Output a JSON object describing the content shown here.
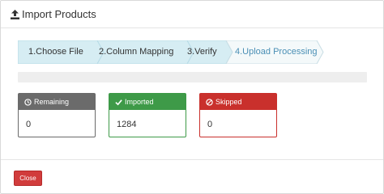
{
  "modal": {
    "title": "Import Products",
    "title_icon": "upload-icon"
  },
  "wizard": {
    "steps": [
      {
        "label": "1.Choose File",
        "state": "completed"
      },
      {
        "label": "2.Column Mapping",
        "state": "completed"
      },
      {
        "label": "3.Verify",
        "state": "completed"
      },
      {
        "label": "4.Upload Processing",
        "state": "active"
      }
    ]
  },
  "progress": {
    "value": 0
  },
  "stats": {
    "remaining": {
      "label": "Remaining",
      "icon": "clock-icon",
      "value": "0",
      "color": "#6b6b6b"
    },
    "imported": {
      "label": "Imported",
      "icon": "check-icon",
      "value": "1284",
      "color": "#3e9a48"
    },
    "skipped": {
      "label": "Skipped",
      "icon": "ban-icon",
      "value": "0",
      "color": "#c9302c"
    }
  },
  "footer": {
    "close_label": "Close"
  },
  "colors": {
    "step_completed": "#d6edf3",
    "step_active": "#f4f9fa",
    "active_text": "#4a8fb5",
    "close_button": "#d13c3c"
  }
}
